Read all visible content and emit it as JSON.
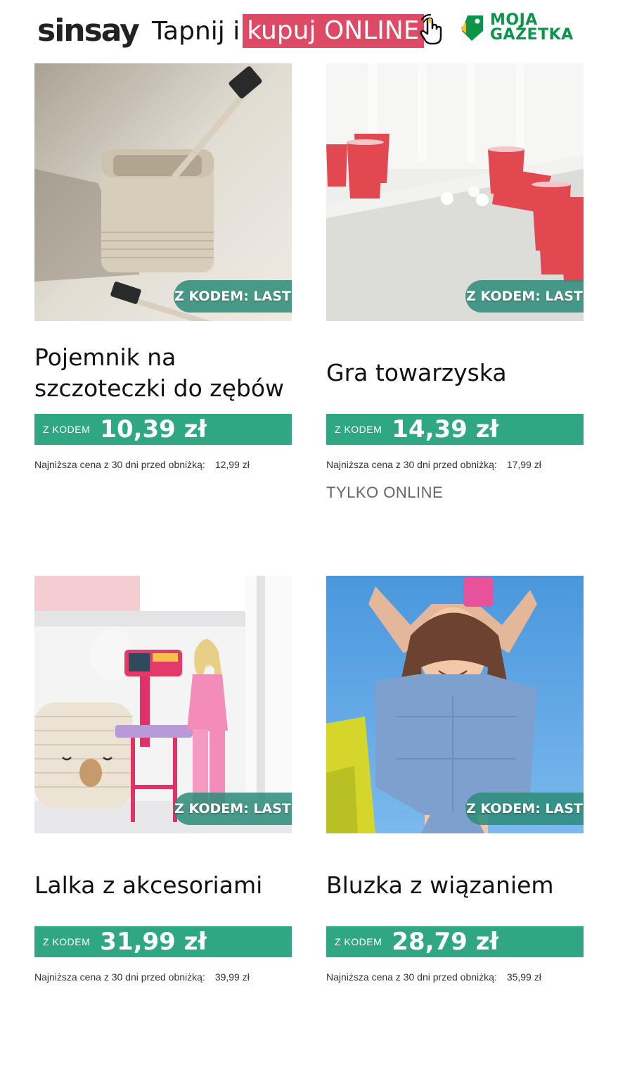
{
  "header": {
    "brand": "sinsay",
    "tagline_plain": "Tapnij i",
    "tagline_highlight": "kupuj ONLINE",
    "tap_icon": "hand-pointer-icon",
    "partner_logo_line1": "MOJA",
    "partner_logo_line2": "GAZETKA",
    "colors": {
      "highlight": "#dc4a66",
      "partner": "#0a9548",
      "price_bar": "#2fa783"
    }
  },
  "products": [
    {
      "image": "toothbrush-holder-photo",
      "badge": "Z KODEM: LAST",
      "title": "Pojemnik na szczoteczki do zębów",
      "price_prefix": "Z KODEM",
      "price": "10,39 zł",
      "lowest_label": "Najniższa cena z 30 dni przed obniżką:",
      "lowest_price": "12,99 zł",
      "extra": ""
    },
    {
      "image": "party-cups-game-photo",
      "badge": "Z KODEM: LAST",
      "title": "Gra towarzyska",
      "price_prefix": "Z KODEM",
      "price": "14,39 zł",
      "lowest_label": "Najniższa cena z 30 dni przed obniżką:",
      "lowest_price": "17,99 zł",
      "extra": "TYLKO ONLINE"
    },
    {
      "image": "doll-with-accessories-photo",
      "badge": "Z KODEM: LAST",
      "title": "Lalka z akcesoriami",
      "price_prefix": "Z KODEM",
      "price": "31,99 zł",
      "lowest_label": "Najniższa cena z 30 dni przed obniżką:",
      "lowest_price": "39,99 zł",
      "extra": ""
    },
    {
      "image": "girl-in-blouse-photo",
      "badge": "Z KODEM: LAST",
      "title": "Bluzka z wiązaniem",
      "price_prefix": "Z KODEM",
      "price": "28,79 zł",
      "lowest_label": "Najniższa cena z 30 dni przed obniżką:",
      "lowest_price": "35,99 zł",
      "extra": ""
    }
  ]
}
